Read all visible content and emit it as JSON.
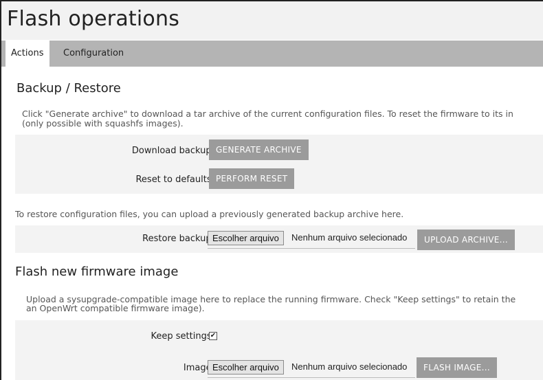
{
  "page": {
    "title": "Flash operations"
  },
  "tabs": [
    {
      "label": "Actions",
      "active": true
    },
    {
      "label": "Configuration",
      "active": false
    }
  ],
  "backup_restore": {
    "title": "Backup / Restore",
    "description_line1": "Click \"Generate archive\" to download a tar archive of the current configuration files. To reset the firmware to its in",
    "description_line2": "(only possible with squashfs images).",
    "download_label": "Download backup:",
    "generate_button": "GENERATE ARCHIVE",
    "reset_label": "Reset to defaults:",
    "reset_button": "PERFORM RESET",
    "restore_text": "To restore configuration files, you can upload a previously generated backup archive here.",
    "restore_label": "Restore backup:",
    "choose_file_button": "Escolher arquivo",
    "no_file_text": "Nenhum arquivo selecionado",
    "upload_button": "UPLOAD ARCHIVE..."
  },
  "flash_firmware": {
    "title": "Flash new firmware image",
    "description_line1": "Upload a sysupgrade-compatible image here to replace the running firmware. Check \"Keep settings\" to retain the",
    "description_line2": "an OpenWrt compatible firmware image).",
    "keep_settings_label": "Keep settings:",
    "keep_settings_checked": true,
    "image_label": "Image:",
    "choose_file_button": "Escolher arquivo",
    "no_file_text": "Nenhum arquivo selecionado",
    "flash_button": "FLASH IMAGE..."
  },
  "colors": {
    "button_bg": "#9b9b9b",
    "tabbar_bg": "#b4b4b4",
    "row_bg": "#f3f3f3"
  }
}
